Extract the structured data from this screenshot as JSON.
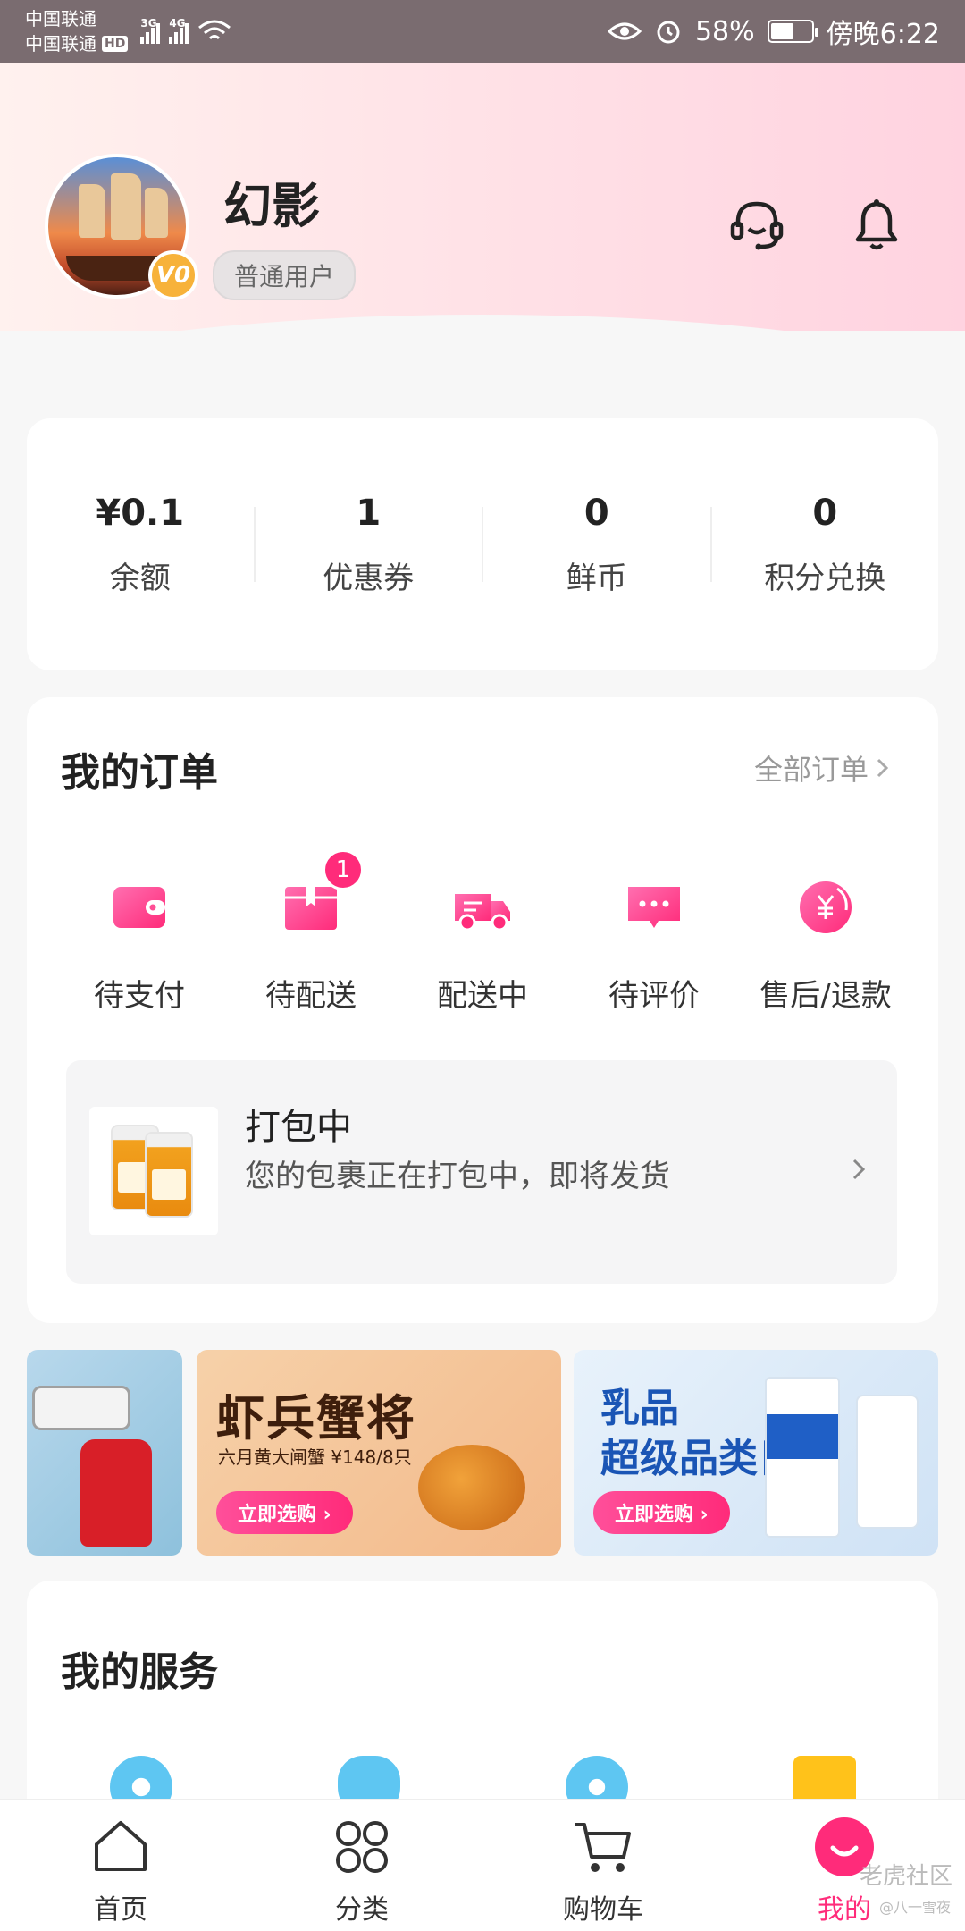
{
  "status_bar": {
    "carrier1": "中国联通",
    "carrier2": "中国联通",
    "hd": "HD",
    "net1": "3G",
    "net2": "4G",
    "battery_percent": "58%",
    "battery_level": 0.58,
    "time": "傍晚6:22"
  },
  "profile": {
    "username": "幻影",
    "level": "普通用户",
    "vip_badge": "V0"
  },
  "wallet": [
    {
      "value": "¥0.1",
      "label": "余额"
    },
    {
      "value": "1",
      "label": "优惠券"
    },
    {
      "value": "0",
      "label": "鲜币"
    },
    {
      "value": "0",
      "label": "积分兑换"
    }
  ],
  "orders": {
    "title": "我的订单",
    "all_link": "全部订单",
    "items": [
      {
        "label": "待支付",
        "icon": "wallet-icon"
      },
      {
        "label": "待配送",
        "icon": "package-icon",
        "badge": "1"
      },
      {
        "label": "配送中",
        "icon": "truck-icon"
      },
      {
        "label": "待评价",
        "icon": "comment-icon"
      },
      {
        "label": "售后/退款",
        "icon": "refund-icon"
      }
    ],
    "packing": {
      "title": "打包中",
      "desc": "您的包裹正在打包中，即将发货"
    }
  },
  "banners": {
    "b2_title": "虾兵蟹将",
    "b2_sub": "六月黄大闸蟹 ¥148/8只",
    "b2_button": "立即选购 ›",
    "b3_title_line1": "乳品",
    "b3_title_line2": "超级品类日",
    "b3_button": "立即选购 ›"
  },
  "services": {
    "title": "我的服务"
  },
  "bottom_nav": [
    {
      "label": "首页",
      "icon": "home-icon"
    },
    {
      "label": "分类",
      "icon": "grid-icon"
    },
    {
      "label": "购物车",
      "icon": "cart-icon"
    },
    {
      "label": "我的",
      "icon": "profile-icon"
    }
  ],
  "watermark": "老虎社区",
  "watermark_sub": "@八一雪夜",
  "colors": {
    "accent": "#ff2b7a",
    "header_gradient_end": "#ffd3e0"
  }
}
